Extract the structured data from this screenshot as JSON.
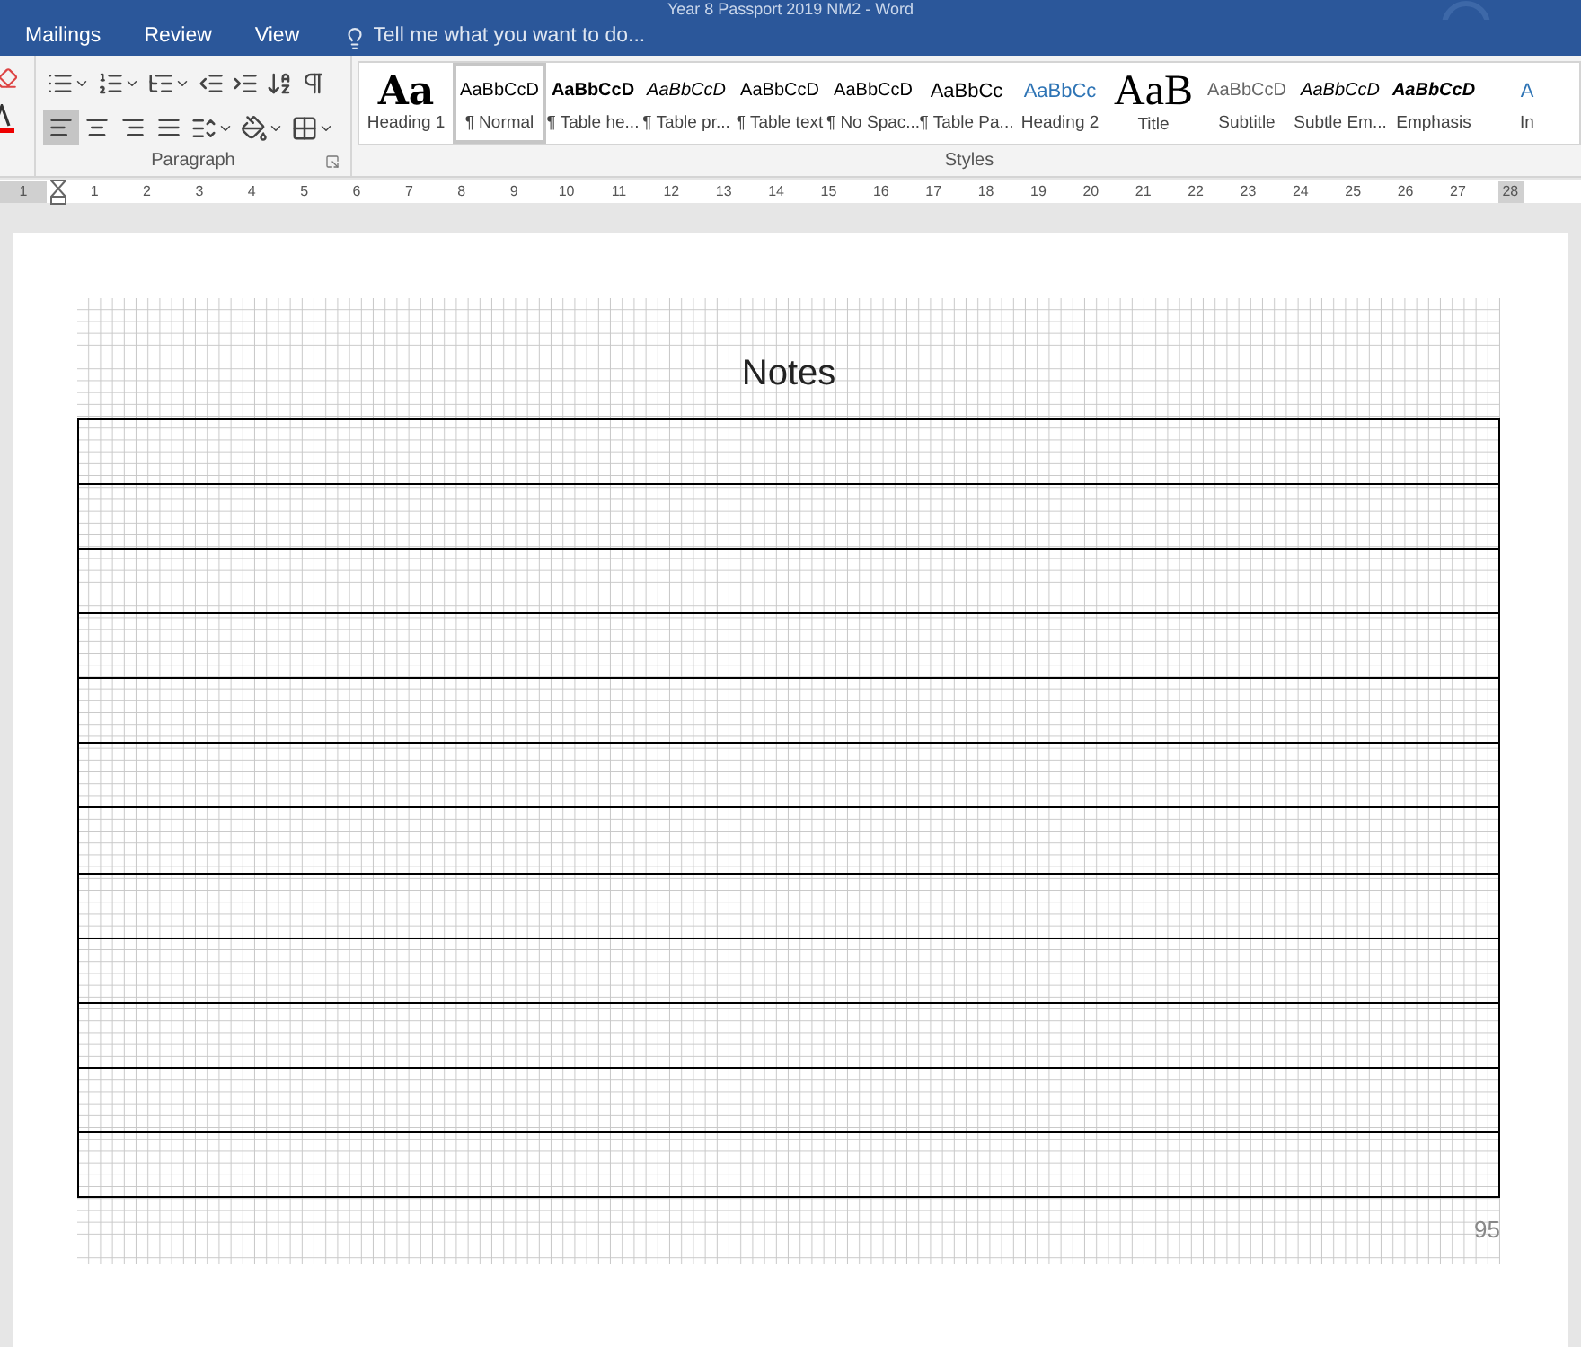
{
  "window": {
    "title": "Year 8 Passport 2019 NM2 - Word"
  },
  "menu": [
    {
      "label": "Mailings"
    },
    {
      "label": "Review"
    },
    {
      "label": "View"
    }
  ],
  "tell_me": {
    "placeholder": "Tell me what you want to do..."
  },
  "paragraph_group": {
    "label": "Paragraph",
    "alignments": [
      {
        "selected": true
      },
      {
        "selected": false
      },
      {
        "selected": false
      },
      {
        "selected": false
      }
    ]
  },
  "styles_group": {
    "label": "Styles",
    "styles": [
      {
        "kind": "heading1",
        "preview": "Aa",
        "label": "Heading 1",
        "selected": false
      },
      {
        "kind": "normal",
        "preview": "AaBbCcD",
        "label": "¶ Normal",
        "selected": true
      },
      {
        "kind": "bold",
        "preview": "AaBbCcD",
        "label": "¶ Table he...",
        "selected": false
      },
      {
        "kind": "italic",
        "preview": "AaBbCcD",
        "label": "¶ Table pr...",
        "selected": false
      },
      {
        "kind": "normal",
        "preview": "AaBbCcD",
        "label": "¶ Table text",
        "selected": false
      },
      {
        "kind": "normal",
        "preview": "AaBbCcD",
        "label": "¶ No Spac...",
        "selected": false
      },
      {
        "kind": "large",
        "preview": "AaBbCc",
        "label": "¶ Table Pa...",
        "selected": false
      },
      {
        "kind": "heading2",
        "preview": "AaBbCc",
        "label": "Heading 2",
        "selected": false
      },
      {
        "kind": "title",
        "preview": "AaB",
        "label": "Title",
        "selected": false
      },
      {
        "kind": "subtitle",
        "preview": "AaBbCcD",
        "label": "Subtitle",
        "selected": false
      },
      {
        "kind": "italic",
        "preview": "AaBbCcD",
        "label": "Subtle Em...",
        "selected": false
      },
      {
        "kind": "bolditalic",
        "preview": "AaBbCcD",
        "label": "Emphasis",
        "selected": false
      },
      {
        "kind": "heading2",
        "preview": "A",
        "label": "In",
        "selected": false
      }
    ]
  },
  "ruler": {
    "labels": [
      "1",
      "1",
      "2",
      "3",
      "4",
      "5",
      "6",
      "7",
      "8",
      "9",
      "10",
      "11",
      "12",
      "13",
      "14",
      "15",
      "16",
      "17",
      "18",
      "19",
      "20",
      "21",
      "22",
      "23",
      "24",
      "25",
      "26",
      "27",
      "28"
    ]
  },
  "page": {
    "heading": "Notes",
    "page_number": "95"
  }
}
